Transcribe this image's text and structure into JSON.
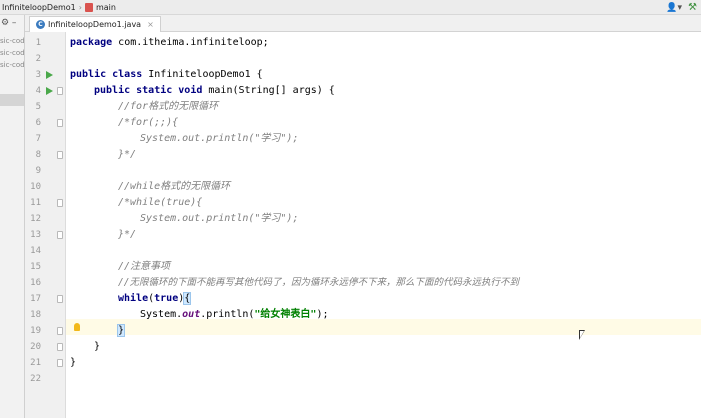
{
  "breadcrumb": {
    "project": "InfiniteloopDemo1",
    "method": "main"
  },
  "tab": {
    "label": "InfiniteloopDemo1.java"
  },
  "project_panel": {
    "items": [
      "sic-code",
      "sic-code",
      "sic-code"
    ]
  },
  "gutter": {
    "line_numbers": [
      "1",
      "2",
      "3",
      "4",
      "5",
      "6",
      "7",
      "8",
      "9",
      "10",
      "11",
      "12",
      "13",
      "14",
      "15",
      "16",
      "17",
      "18",
      "19",
      "20",
      "21",
      "22"
    ]
  },
  "code": {
    "l1_kw": "package",
    "l1_rest": " com.itheima.infiniteloop;",
    "l3_kw": "public class",
    "l3_rest": " InfiniteloopDemo1 {",
    "l4_kw": "public static void",
    "l4_rest": " main(String[] args) {",
    "l5_cmt": "//for格式的无限循环",
    "l6_cmt": "/*for(;;){",
    "l7_cmt": "System.out.println(\"学习\");",
    "l8_cmt": "}*/",
    "l10_cmt": "//while格式的无限循环",
    "l11_cmt": "/*while(true){",
    "l12_cmt": "System.out.println(\"学习\");",
    "l13_cmt": "}*/",
    "l15_cmt": "//注意事项",
    "l16_cmt": "//无限循环的下面不能再写其他代码了，因为循环永远停不下来，那么下面的代码永远执行不到",
    "l17_kw": "while",
    "l17_open": "(",
    "l17_true": "true",
    "l17_rest": ")",
    "l17_brace": "{",
    "l18_sys": "System.",
    "l18_out": "out",
    "l18_mid": ".println(",
    "l18_str": "\"给女神表白\"",
    "l18_end": ");",
    "l19_brace": "}",
    "l20": "}",
    "l21": "}"
  }
}
